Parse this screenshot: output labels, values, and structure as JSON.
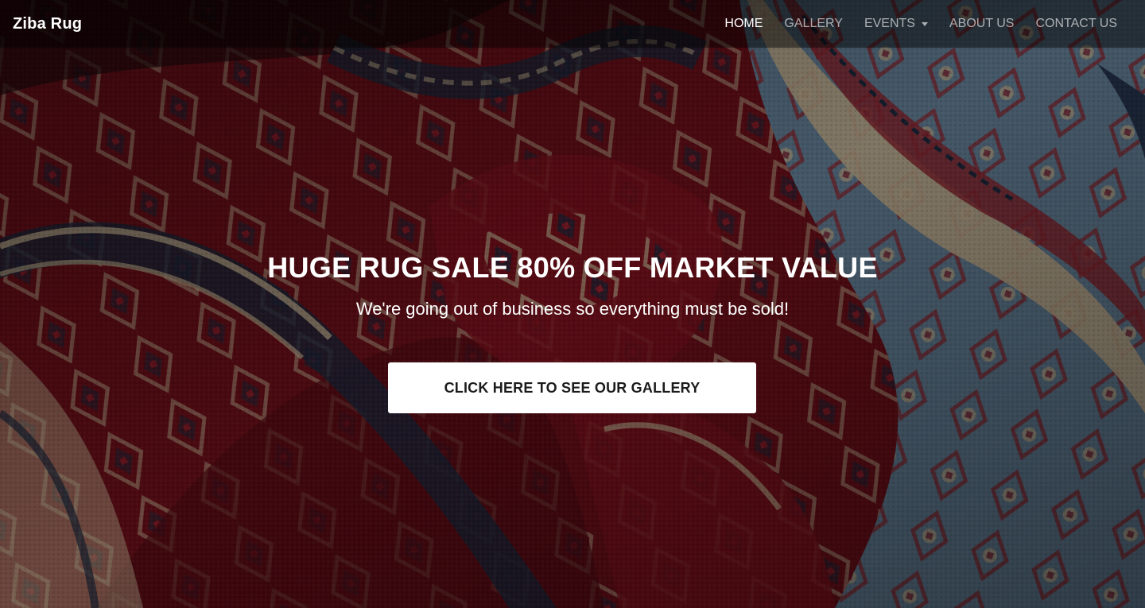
{
  "navbar": {
    "brand": "Ziba Rug",
    "links": [
      {
        "label": "HOME",
        "active": true
      },
      {
        "label": "GALLERY",
        "active": false
      },
      {
        "label": "EVENTS",
        "active": false,
        "dropdown": true
      },
      {
        "label": "ABOUT US",
        "active": false
      },
      {
        "label": "CONTACT US",
        "active": false
      }
    ]
  },
  "hero": {
    "background_image": "persian-rugs-photo",
    "headline": "HUGE RUG SALE 80% OFF MARKET VALUE",
    "subheadline": "We're going out of business so everything must be sold!",
    "cta_label": "CLICK HERE TO SEE OUR GALLERY"
  },
  "colors": {
    "rug_red": "#8e1320",
    "rug_navy": "#1f2c44",
    "rug_cream": "#d8c3a0",
    "rug_blue": "#6f8ea8",
    "text_white": "#ffffff",
    "cta_text": "#1b1b1b"
  }
}
